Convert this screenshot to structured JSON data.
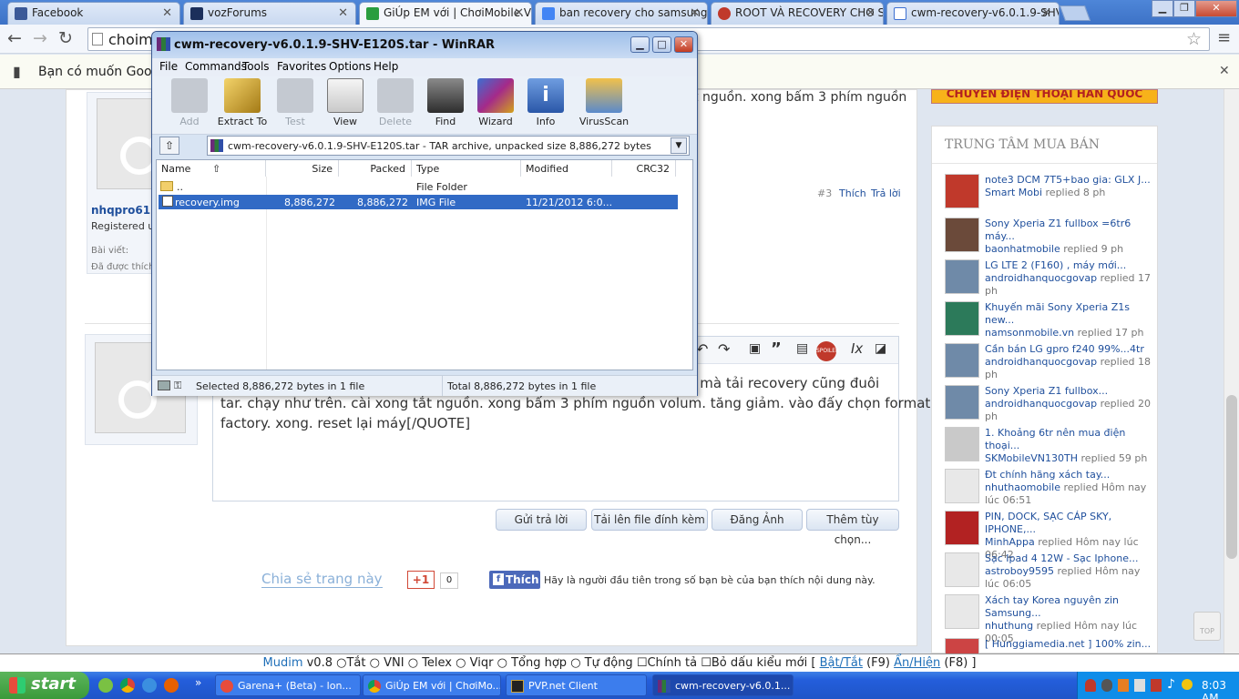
{
  "browser": {
    "tabs": [
      {
        "title": "Facebook",
        "favicon_color": "#3b5998"
      },
      {
        "title": "vozForums",
        "favicon_color": "#1b2f5b"
      },
      {
        "title": "GiÚp EM với | ChơiMobile.Vn",
        "favicon_color": "#2a9d3f"
      },
      {
        "title": "ban recovery cho samsung s",
        "favicon_color": "#4285f4"
      },
      {
        "title": "ROOT VÀ RECOVERY CHO S:",
        "favicon_color": "#c0392b"
      },
      {
        "title": "cwm-recovery-v6.0.1.9-SHV",
        "favicon_color": "#3c6fd1"
      }
    ],
    "omnibox_text": "choim",
    "infobar_text": "Bạn có muốn Google"
  },
  "page": {
    "post1": {
      "snippet": "t nguồn. xong bấm 3 phím nguồn",
      "username": "nhqpro612",
      "role": "Registered us",
      "posts_label": "Bài viết:",
      "likes_label": "Đã được thích",
      "post_number": "#3",
      "like_link": "Thích",
      "reply_link": "Trả lời"
    },
    "reply_editor": {
      "line1": "n mà tải recovery cũng đuôi",
      "line2": "tar. chạy như trên. cài xong tắt nguồn. xong bấm 3 phím nguồn volum. tăng giảm. vào đấy chọn format",
      "line3": "factory. xong. reset lại máy[/QUOTE]",
      "spoiler_label": "SPOILER"
    },
    "buttons": {
      "send_reply": "Gửi trả lời",
      "upload_file": "Tải lên file đính kèm",
      "post_image": "Đăng Ảnh",
      "more_options": "Thêm tùy chọn..."
    },
    "share": {
      "share_label": "Chia sẻ trang này",
      "gplus_label": "+1",
      "gplus_count": "0",
      "fb_like": "Thích",
      "fb_text": "Hãy là người đầu tiên trong số bạn bè của bạn thích nội dung này."
    },
    "banner_text": "CHUYÊN ĐIỆN THOẠI HÀN QUỐC",
    "top_button": "TOP"
  },
  "sidebar": {
    "title": "TRUNG TÂM MUA BÁN",
    "items": [
      {
        "title": "note3 DCM 7T5+bao gia: GLX J...",
        "user": "Smart Mobi",
        "meta": " replied 8 ph"
      },
      {
        "title": "Sony Xperia Z1 fullbox =6tr6 máy...",
        "user": "baonhatmobile",
        "meta": " replied 9 ph"
      },
      {
        "title": "LG LTE 2 (F160) , máy mới...",
        "user": "androidhanquocgovap",
        "meta": " replied 17 ph"
      },
      {
        "title": "Khuyến mãi Sony Xperia Z1s new...",
        "user": "namsonmobile.vn",
        "meta": " replied 17 ph"
      },
      {
        "title": "Cần bán LG gpro f240 99%...4tr",
        "user": "androidhanquocgovap",
        "meta": " replied 18 ph"
      },
      {
        "title": "Sony Xperia Z1 fullbox...",
        "user": "androidhanquocgovap",
        "meta": " replied 20 ph"
      },
      {
        "title": "1. Khoảng 6tr nên mua điện thoại...",
        "user": "SKMobileVN130TH",
        "meta": " replied 59 ph"
      },
      {
        "title": "Đt chính hãng xách tay...",
        "user": "nhuthaomobile",
        "meta": " replied Hôm nay lúc 06:51"
      },
      {
        "title": "PIN, DOCK, SẠC CÁP SKY, IPHONE,...",
        "user": "MinhAppa",
        "meta": " replied Hôm nay lúc 06:42"
      },
      {
        "title": "Sạc Ipad 4 12W - Sạc Iphone...",
        "user": "astroboy9595",
        "meta": " replied Hôm nay lúc 06:05"
      },
      {
        "title": "Xách tay Korea nguyên zin Samsung...",
        "user": "nhuthung",
        "meta": " replied Hôm nay lúc 00:05"
      },
      {
        "title": "[ Hunggiamedia.net ] 100% zin...",
        "user": "",
        "meta": ""
      }
    ]
  },
  "winrar": {
    "title": "cwm-recovery-v6.0.1.9-SHV-E120S.tar - WinRAR",
    "menu": [
      "File",
      "Commands",
      "Tools",
      "Favorites",
      "Options",
      "Help"
    ],
    "tools": [
      "Add",
      "Extract To",
      "Test",
      "View",
      "Delete",
      "Find",
      "Wizard",
      "Info",
      "VirusScan"
    ],
    "path_text": "cwm-recovery-v6.0.1.9-SHV-E120S.tar - TAR archive, unpacked size 8,886,272 bytes",
    "columns": [
      "Name",
      "Size",
      "Packed",
      "Type",
      "Modified",
      "CRC32"
    ],
    "rows": [
      {
        "name": "..",
        "size": "",
        "packed": "",
        "type": "File Folder",
        "modified": ""
      },
      {
        "name": "recovery.img",
        "size": "8,886,272",
        "packed": "8,886,272",
        "type": "IMG File",
        "modified": "11/21/2012 6:0..."
      }
    ],
    "status_selected": "Selected 8,886,272 bytes in 1 file",
    "status_total": "Total 8,886,272 bytes in 1 file"
  },
  "mudim": {
    "brand": "Mudim",
    "version": " v0.8 ",
    "options": [
      "Tắt",
      "VNI",
      "Telex",
      "Viqr",
      "Tổng hợp",
      "Tự động"
    ],
    "check1": "Chính tả",
    "check2": "Bỏ dấu kiểu mới",
    "toggle": "Bật/Tắt",
    "f9": " (F9) ",
    "showhide": "Ẩn/Hiện",
    "f8": " (F8) ]"
  },
  "taskbar": {
    "start": "start",
    "tasks": [
      "Garena+ (Beta) - lon...",
      "GiÚp EM với | ChơiMo...",
      "PVP.net Client",
      "cwm-recovery-v6.0.1..."
    ],
    "clock": "8:03 AM"
  }
}
